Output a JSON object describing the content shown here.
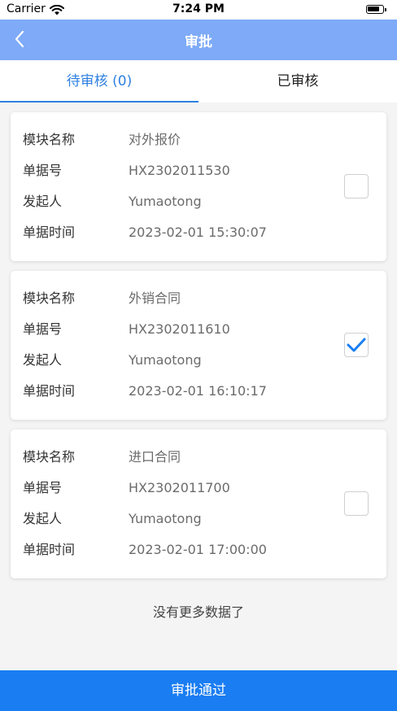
{
  "status_bar": {
    "carrier": "Carrier",
    "time": "7:24 PM"
  },
  "navbar": {
    "title": "审批",
    "back_icon": "chevron-left-icon"
  },
  "tabs": [
    {
      "label": "待审核 (0)",
      "active": true
    },
    {
      "label": "已审核",
      "active": false
    }
  ],
  "field_labels": {
    "module": "模块名称",
    "doc_no": "单据号",
    "initiator": "发起人",
    "doc_time": "单据时间"
  },
  "records": [
    {
      "module": "对外报价",
      "doc_no": "HX2302011530",
      "initiator": "Yumaotong",
      "doc_time": "2023-02-01 15:30:07",
      "checked": false
    },
    {
      "module": "外销合同",
      "doc_no": "HX2302011610",
      "initiator": "Yumaotong",
      "doc_time": "2023-02-01 16:10:17",
      "checked": true
    },
    {
      "module": "进口合同",
      "doc_no": "HX2302011700",
      "initiator": "Yumaotong",
      "doc_time": "2023-02-01 17:00:00",
      "checked": false
    }
  ],
  "no_more_text": "没有更多数据了",
  "approve_button": "审批通过",
  "colors": {
    "navbar": "#7eaaf7",
    "accent": "#2f80e0",
    "button": "#1a7df2",
    "checkmark": "#1a7df2"
  }
}
